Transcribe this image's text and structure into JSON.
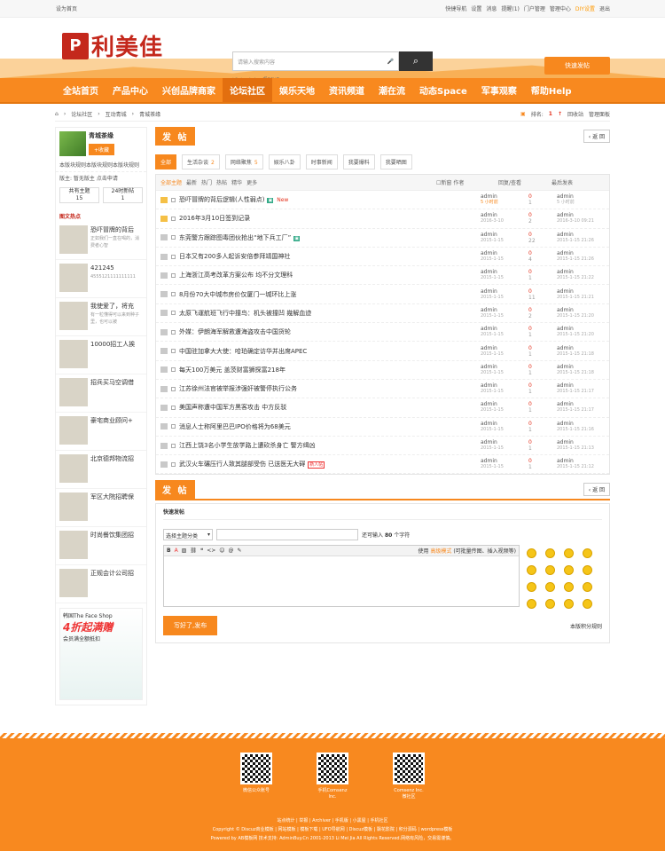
{
  "topbar": {
    "home": "设为首页",
    "links": [
      "快捷导航",
      "设置",
      "消息",
      "提醒(1)",
      "门户管理",
      "管理中心",
      "DIY设置",
      "退出"
    ]
  },
  "header": {
    "logo_mark": "P",
    "logo_text": "利美佳",
    "search_placeholder": "请输入搜索内容",
    "search_icon": "magnifier",
    "mic_icon": "mic",
    "hotwords": [
      "活动",
      "交友",
      "discuz"
    ],
    "quick_post": "快速发帖"
  },
  "nav": [
    "全站首页",
    "产品中心",
    "兴创品牌商家",
    "论坛社区",
    "娱乐天地",
    "资讯频道",
    "潮在流",
    "动态Space",
    "军事观察",
    "帮助Help"
  ],
  "crumbs": [
    "论坛社区",
    "互动青城",
    "青城茶缘"
  ],
  "crumb_right": {
    "rank_label": "排名:",
    "rank_value": "1",
    "recycle": "回收站",
    "manage": "管理面板"
  },
  "side": {
    "forum_name": "青城茶缘",
    "fav": "+收藏",
    "desc": "本版块规则本版块规则本版块规则",
    "mods": "版主: 暂无版主 点击申请",
    "stats": [
      {
        "label": "共有主题",
        "value": "15"
      },
      {
        "label": "24时新帖",
        "value": "1"
      }
    ],
    "hot_title": "图文热点",
    "hot": [
      {
        "title": "恐吓冒牌的背后",
        "sub": "正如我们一直在喝的，消费者心智"
      },
      {
        "title": "421245",
        "sub": "4555121111111111"
      },
      {
        "title": "我使爱了，将充",
        "sub": "有一粒懂得可以来到种子里，也可以被"
      },
      {
        "title": "10000招工人挨",
        "sub": ""
      },
      {
        "title": "招兵买马空调借",
        "sub": ""
      },
      {
        "title": "豪宅商业顾问+",
        "sub": ""
      },
      {
        "title": "北京德邦物流招",
        "sub": ""
      },
      {
        "title": "军区大院招聘保",
        "sub": ""
      },
      {
        "title": "时尚餐饮集团招",
        "sub": ""
      },
      {
        "title": "正规会计公司招",
        "sub": ""
      }
    ],
    "ad": {
      "brand": "韩国The Face Shop",
      "big": "4折起满赠",
      "small": "会员满全额抵扣"
    }
  },
  "content": {
    "post_btn": "发 帖",
    "back": "返 回",
    "tabs": [
      {
        "label": "全部",
        "n": ""
      },
      {
        "label": "生活杂谈",
        "n": "2"
      },
      {
        "label": "网络聚焦",
        "n": "5"
      },
      {
        "label": "娱乐八卦",
        "n": ""
      },
      {
        "label": "时事新闻",
        "n": ""
      },
      {
        "label": "我要爆料",
        "n": ""
      },
      {
        "label": "我要晒图",
        "n": ""
      }
    ],
    "thead": {
      "filters": [
        "全部主题",
        "最新",
        "热门",
        "热帖",
        "精华",
        "更多"
      ],
      "new_window": "新窗",
      "author": "作者",
      "reply": "回复/查看",
      "last": "最后发表"
    },
    "threads": [
      {
        "title": "恐吓冒牌的背后逻辑(人性弱点)",
        "pin": true,
        "new": "New",
        "badge": "img",
        "a": "admin",
        "ad": "5 小时前",
        "r": "0",
        "v": "1",
        "l": "admin",
        "ld": "5 小时前"
      },
      {
        "title": "2016年3月10日签到记录",
        "pin": true,
        "a": "admin",
        "ad": "2016-3-10",
        "r": "0",
        "v": "2",
        "l": "admin",
        "ld": "2016-3-10 09:21"
      },
      {
        "title": "东莞警方跟踪图毒团伙抢出“地下兵工厂”",
        "badge": "img",
        "a": "admin",
        "ad": "2015-1-15",
        "r": "0",
        "v": "22",
        "l": "admin",
        "ld": "2015-1-15 21:26"
      },
      {
        "title": "日本又有200多人起诉安倍参拜靖国神社",
        "a": "admin",
        "ad": "2015-1-15",
        "r": "0",
        "v": "4",
        "l": "admin",
        "ld": "2015-1-15 21:26"
      },
      {
        "title": "上海浙江高考改革方案公布 均不分文理科",
        "a": "admin",
        "ad": "2015-1-15",
        "r": "0",
        "v": "1",
        "l": "admin",
        "ld": "2015-1-15 21:22"
      },
      {
        "title": "8月份70大中城市房价仅厦门一城环比上涨",
        "a": "admin",
        "ad": "2015-1-15",
        "r": "0",
        "v": "11",
        "l": "admin",
        "ld": "2015-1-15 21:21"
      },
      {
        "title": "太原飞運航班飞行中撞鸟：机头被撞凹 幾解血迹",
        "a": "admin",
        "ad": "2015-1-15",
        "r": "0",
        "v": "2",
        "l": "admin",
        "ld": "2015-1-15 21:20"
      },
      {
        "title": "外媒：伊朗海军解救遭海盗攻击中国货轮",
        "a": "admin",
        "ad": "2015-1-15",
        "r": "0",
        "v": "1",
        "l": "admin",
        "ld": "2015-1-15 21:20"
      },
      {
        "title": "中国驻加拿大大使：哈珀确定访华并出席APEC",
        "a": "admin",
        "ad": "2015-1-15",
        "r": "0",
        "v": "1",
        "l": "admin",
        "ld": "2015-1-15 21:18"
      },
      {
        "title": "每天100万美元 盖茨财富狮探富218年",
        "a": "admin",
        "ad": "2015-1-15",
        "r": "0",
        "v": "1",
        "l": "admin",
        "ld": "2015-1-15 21:18"
      },
      {
        "title": "江苏徐州法官被举报涉强奸被警停执行公务",
        "a": "admin",
        "ad": "2015-1-15",
        "r": "0",
        "v": "1",
        "l": "admin",
        "ld": "2015-1-15 21:17"
      },
      {
        "title": "美国声称遭中国军方黑客攻击 中方反驳",
        "a": "admin",
        "ad": "2015-1-15",
        "r": "0",
        "v": "1",
        "l": "admin",
        "ld": "2015-1-15 21:17"
      },
      {
        "title": "消息人士称阿里巴巴IPO价格将为68美元",
        "a": "admin",
        "ad": "2015-1-15",
        "r": "0",
        "v": "1",
        "l": "admin",
        "ld": "2015-1-15 21:16"
      },
      {
        "title": "江西上饶3名小学生放学路上遭砍杀身亡 警方缉凶",
        "a": "admin",
        "ad": "2015-1-15",
        "r": "0",
        "v": "1",
        "l": "admin",
        "ld": "2015-1-15 21:13"
      },
      {
        "title": "武汉火车碾压行人致其腿部受伤 已送医无大碍",
        "badge2": "新人帖",
        "a": "admin",
        "ad": "2015-1-15",
        "r": "0",
        "v": "1",
        "l": "admin",
        "ld": "2015-1-15 21:12"
      }
    ],
    "quick": {
      "label": "快速发帖",
      "select": "选择主题分类",
      "hint_pre": "还可输入",
      "hint_num": "80",
      "hint_post": "个字符",
      "tools": [
        "B",
        "A",
        "img",
        "link",
        "quote",
        "code",
        "smile",
        "@",
        "attach"
      ],
      "adv_pre": "使用",
      "adv": "高级模式",
      "adv_post": "(可批量传图、插入视频等)",
      "submit": "写好了,发布",
      "rules": "本版积分规则"
    }
  },
  "footer": {
    "qrs": [
      "微信公众账号",
      "手机Comsenz Inc.",
      "Comsenz Inc.微社区"
    ],
    "links": "站点统计 | 举报 | Archiver | 手机版 | 小黑屋 | 手机社区",
    "copy": "Copyright © Discuz商业模板 | 网站模板 | 模板下载 | UFO导航网 | Discuz模板 | 飘花影院 | 积分源码 | wordpress模板",
    "power": "Powered by AB模板网 技术支持: AdminBuy.Cn 2001-2013 Li Mei Jia All Rights Reserved.网络有风险，交易需谨慎。"
  }
}
